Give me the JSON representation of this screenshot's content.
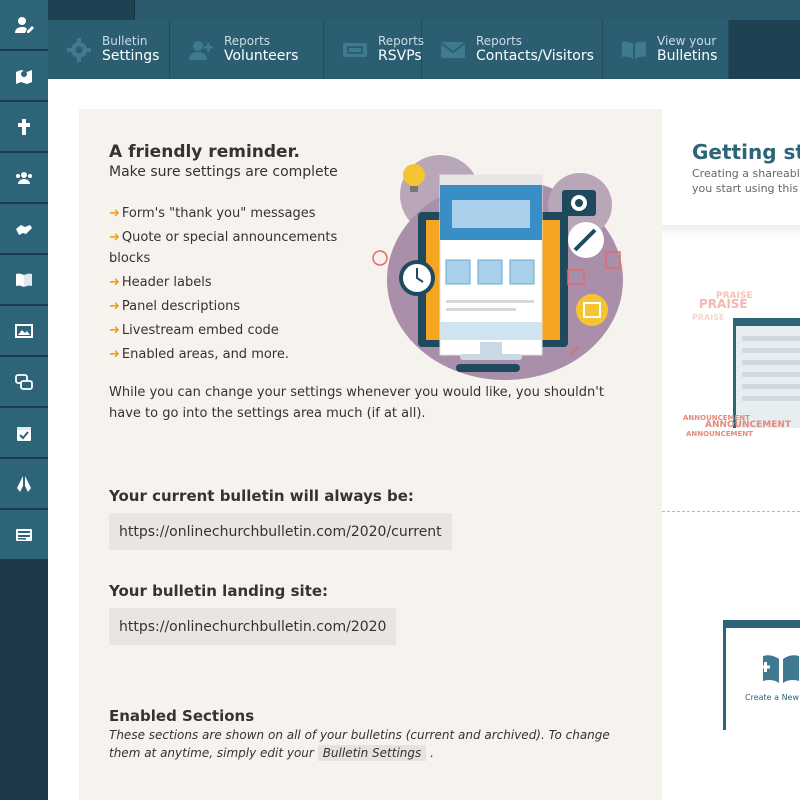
{
  "sidebar": {
    "items": [
      {
        "icon": "user-edit-icon"
      },
      {
        "icon": "map-icon"
      },
      {
        "icon": "cross-icon"
      },
      {
        "icon": "users-icon"
      },
      {
        "icon": "handshake-icon"
      },
      {
        "icon": "book-icon"
      },
      {
        "icon": "image-icon"
      },
      {
        "icon": "chat-icon"
      },
      {
        "icon": "calendar-check-icon"
      },
      {
        "icon": "praying-hands-icon"
      },
      {
        "icon": "list-icon"
      }
    ]
  },
  "tabs": [
    {
      "small": "Bulletin",
      "big": "Settings",
      "icon": "gear-icon"
    },
    {
      "small": "Reports",
      "big": "Volunteers",
      "icon": "user-plus-icon"
    },
    {
      "small": "Reports",
      "big": "RSVPs",
      "icon": "ticket-icon"
    },
    {
      "small": "Reports",
      "big": "Contacts/Visitors",
      "icon": "envelope-icon"
    },
    {
      "small": "View your",
      "big": "Bulletins",
      "icon": "book-open-icon"
    }
  ],
  "reminder": {
    "title": "A friendly reminder.",
    "subtitle": "Make sure settings are complete",
    "items": [
      "Form's \"thank you\" messages",
      "Quote or special announcements blocks",
      "Header labels",
      "Panel descriptions",
      "Livestream embed code",
      "Enabled areas, and more."
    ],
    "paragraph": "While you can change your settings whenever you would like, you shouldn't have to go into the settings area much (if at all)."
  },
  "current": {
    "label": "Your current bulletin will always be:",
    "url": "https://onlinechurchbulletin.com/2020/current"
  },
  "landing": {
    "label": "Your bulletin landing site:",
    "url": "https://onlinechurchbulletin.com/2020"
  },
  "enabled": {
    "title": "Enabled Sections",
    "desc_before": "These sections are shown on all of your bulletins (current and archived). To change them at anytime, simply edit your",
    "button": "Bulletin Settings",
    "desc_after": "."
  },
  "getting_started": {
    "title": "Getting star",
    "sub_line1": "Creating a shareabl",
    "sub_line2": "you start using this"
  },
  "preview": {
    "praise_words": [
      "PRAISE",
      "PRAISE",
      "PRAISE",
      "ANNOUNCEMENT",
      "ANNOUNCEMENT",
      "ANNOUNCEMENT"
    ],
    "create_label": "Create a New Bull"
  },
  "colors": {
    "accent": "#2e6478",
    "sidebar": "#2e6478",
    "bullet_arrow": "#f0a020",
    "card_bg": "#f6f3ef"
  }
}
